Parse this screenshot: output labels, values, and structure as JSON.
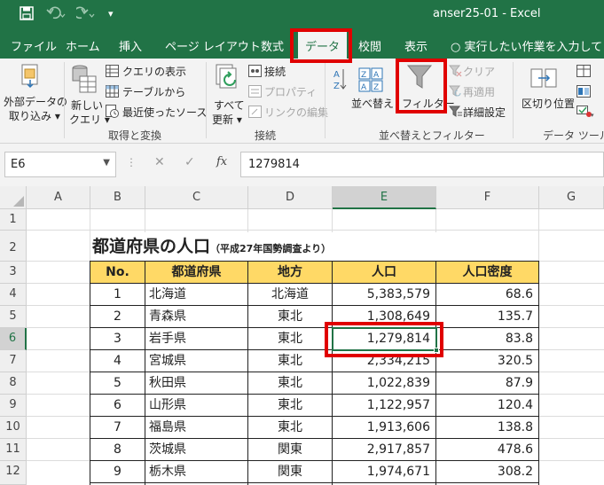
{
  "titlebar": {
    "title": "anser25-01  -  Excel",
    "save_icon": "save-icon",
    "undo_icon": "undo-icon",
    "redo_icon": "redo-icon",
    "customize": "▾"
  },
  "tabs": [
    "ファイル",
    "ホーム",
    "挿入",
    "ページ レイアウト",
    "数式",
    "データ",
    "校閲",
    "表示"
  ],
  "active_tab": "データ",
  "tell_me": "実行したい作業を入力してください",
  "ribbon": {
    "external_data": {
      "line1": "外部データの",
      "line2": "取り込み ▾"
    },
    "new_query": {
      "line1": "新しい",
      "line2": "クエリ ▾"
    },
    "show_queries": "クエリの表示",
    "from_table": "テーブルから",
    "recent_sources": "最近使ったソース",
    "group_get_transform": "取得と変換",
    "refresh_all": {
      "line1": "すべて",
      "line2": "更新 ▾"
    },
    "connections": "接続",
    "properties": "プロパティ",
    "edit_links": "リンクの編集",
    "group_connections": "接続",
    "sort": "並べ替え",
    "filter": "フィルター",
    "clear": "クリア",
    "reapply": "再適用",
    "advanced": "詳細設定",
    "group_sort_filter": "並べ替えとフィルター",
    "text_to_columns": "区切り位置",
    "group_data_tools": "データ ツール"
  },
  "formula_bar": {
    "name_box": "E6",
    "cancel": "✕",
    "enter": "✓",
    "fx": "fx",
    "value": "1279814"
  },
  "columns": [
    "A",
    "B",
    "C",
    "D",
    "E",
    "F",
    "G"
  ],
  "rows": [
    "1",
    "2",
    "3",
    "4",
    "5",
    "6",
    "7",
    "8",
    "9",
    "10",
    "11",
    "12"
  ],
  "sheet": {
    "title": "都道府県の人口",
    "subtitle": "（平成27年国勢調査より）",
    "headers": [
      "No.",
      "都道府県",
      "地方",
      "人口",
      "人口密度"
    ],
    "data": [
      [
        "1",
        "北海道",
        "北海道",
        "5,383,579",
        "68.6"
      ],
      [
        "2",
        "青森県",
        "東北",
        "1,308,649",
        "135.7"
      ],
      [
        "3",
        "岩手県",
        "東北",
        "1,279,814",
        "83.8"
      ],
      [
        "4",
        "宮城県",
        "東北",
        "2,334,215",
        "320.5"
      ],
      [
        "5",
        "秋田県",
        "東北",
        "1,022,839",
        "87.9"
      ],
      [
        "6",
        "山形県",
        "東北",
        "1,122,957",
        "120.4"
      ],
      [
        "7",
        "福島県",
        "東北",
        "1,913,606",
        "138.8"
      ],
      [
        "8",
        "茨城県",
        "関東",
        "2,917,857",
        "478.6"
      ],
      [
        "9",
        "栃木県",
        "関東",
        "1,974,671",
        "308.2"
      ]
    ]
  },
  "colors": {
    "excel_green": "#217346",
    "header_fill": "#ffd966",
    "highlight": "#e00000"
  }
}
